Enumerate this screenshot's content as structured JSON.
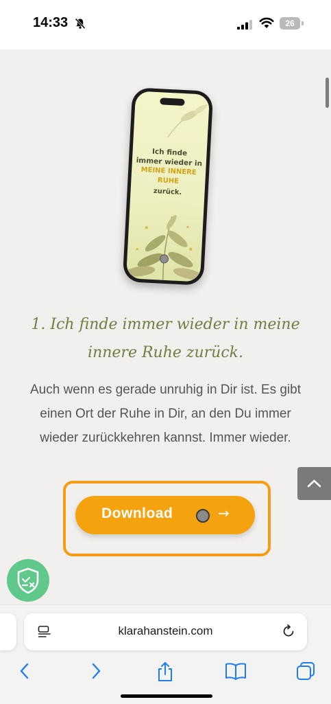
{
  "status_bar": {
    "time": "14:33",
    "battery": "26"
  },
  "content": {
    "mockup": {
      "line1": "Ich finde",
      "line2": "immer wieder in",
      "line3": "MEINE INNERE",
      "line4": "RUHE",
      "line5": "zurück."
    },
    "heading": "1. Ich finde immer wieder in meine innere Ruhe zurück.",
    "body": "Auch wenn es gerade unruhig in Dir ist. Es gibt einen Ort der Ruhe in Dir, an den Du immer wieder zurückkehren kannst. Immer wieder.",
    "download_label": "Download",
    "download_arrow": "→"
  },
  "browser": {
    "url": "klarahanstein.com"
  },
  "icons": {
    "bell": "bell-slash-icon",
    "signal": "signal-icon",
    "wifi": "wifi-icon",
    "back_to_top": "chevron-up-icon",
    "cookie": "shield-check-icon",
    "reader": "reader-icon",
    "reload": "reload-icon",
    "back": "chevron-left-icon",
    "forward": "chevron-right-icon",
    "share": "share-icon",
    "bookmarks": "book-icon",
    "tabs": "tabs-icon"
  },
  "colors": {
    "accent": "#f5a20f",
    "highlight": "#f59b14",
    "heading": "#6d7f42",
    "cookie_badge": "#5fc88a"
  }
}
